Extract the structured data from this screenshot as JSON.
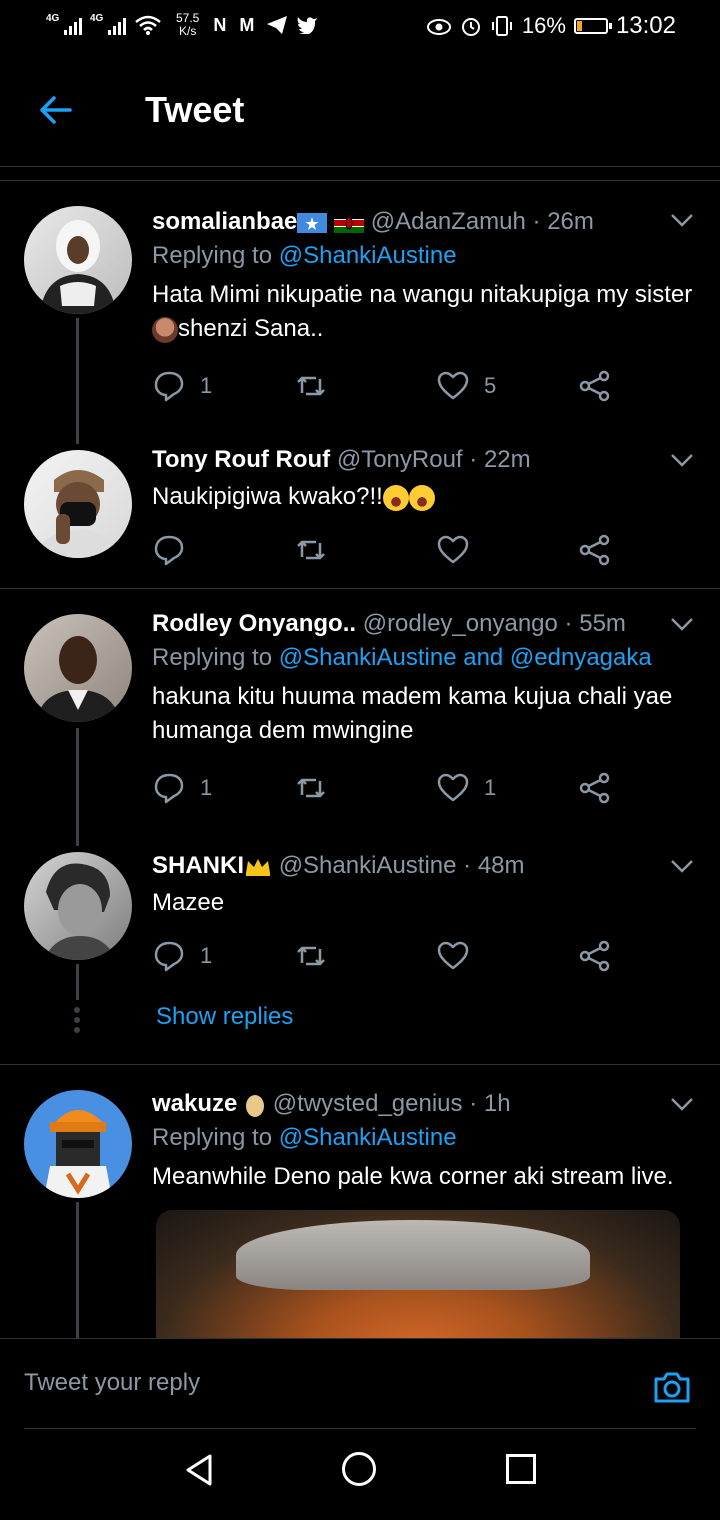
{
  "status_bar": {
    "net1": "4G",
    "net2": "4G",
    "speed_value": "57.5",
    "speed_unit": "K/s",
    "app_icons": "N M",
    "battery": "16%",
    "battery_level": 0.16,
    "time": "13:02"
  },
  "header": {
    "title": "Tweet"
  },
  "tweets": [
    {
      "name": "somalianbae",
      "handle": "@AdanZamuh",
      "separator": "·",
      "time": "26m",
      "reply_prefix": "Replying to",
      "reply_to": "@ShankiAustine",
      "text_before_emoji": "Hata Mimi nikupatie na wangu nitakupiga my sister ",
      "text_after_emoji": "shenzi Sana..",
      "replies": "1",
      "retweets": "",
      "likes": "5"
    },
    {
      "name": "Tony Rouf Rouf",
      "handle": "@TonyRouf",
      "separator": "·",
      "time": "22m",
      "text": "Naukipigiwa kwako?!!",
      "replies": "",
      "retweets": "",
      "likes": ""
    },
    {
      "name": "Rodley Onyango..",
      "handle": "@rodley_onyango",
      "separator": "·",
      "time": "55m",
      "reply_prefix": "Replying to",
      "reply_to": "@ShankiAustine and @ednyagaka",
      "text": "hakuna kitu huuma madem kama kujua chali yae humanga dem mwingine",
      "replies": "1",
      "retweets": "",
      "likes": "1"
    },
    {
      "name": "SHANKI",
      "handle": "@ShankiAustine",
      "separator": "·",
      "time": "48m",
      "text": "Mazee",
      "replies": "1",
      "retweets": "",
      "likes": ""
    },
    {
      "name": "wakuze",
      "handle": "@twysted_genius",
      "separator": "·",
      "time": "1h",
      "reply_prefix": "Replying to",
      "reply_to": "@ShankiAustine",
      "text": "Meanwhile Deno pale kwa corner aki stream live."
    }
  ],
  "show_replies": "Show replies",
  "composer": {
    "placeholder": "Tweet your reply"
  },
  "colors": {
    "accent": "#1da1f2",
    "muted": "#8b98a5",
    "divider": "#2f3336",
    "background": "#000000"
  }
}
